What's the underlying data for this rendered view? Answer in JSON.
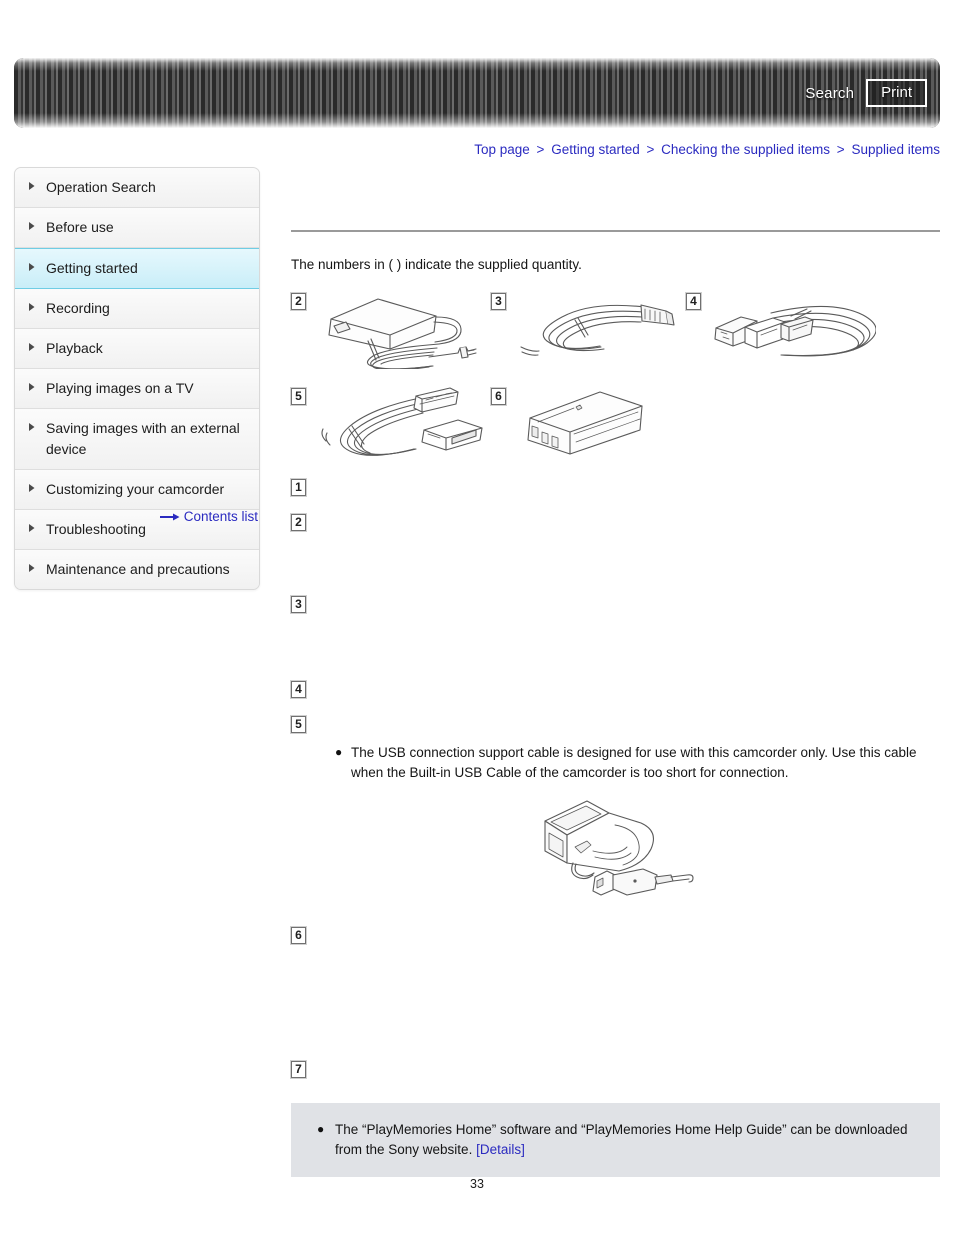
{
  "header": {
    "search_label": "Search",
    "print_label": "Print"
  },
  "breadcrumb": {
    "separator": ">",
    "items": [
      {
        "label": "Top page"
      },
      {
        "label": "Getting started"
      },
      {
        "label": "Checking the supplied items"
      },
      {
        "label": "Supplied items"
      }
    ]
  },
  "sidebar": {
    "items": [
      {
        "label": "Operation Search",
        "active": false
      },
      {
        "label": "Before use",
        "active": false
      },
      {
        "label": "Getting started",
        "active": true
      },
      {
        "label": "Recording",
        "active": false
      },
      {
        "label": "Playback",
        "active": false
      },
      {
        "label": "Playing images on a TV",
        "active": false
      },
      {
        "label": "Saving images with an external device",
        "active": false
      },
      {
        "label": "Customizing your camcorder",
        "active": false
      },
      {
        "label": "Troubleshooting",
        "active": false
      },
      {
        "label": "Maintenance and precautions",
        "active": false
      }
    ],
    "contents_list_label": "Contents list"
  },
  "main": {
    "intro": "The numbers in ( ) indicate the supplied quantity.",
    "figures": [
      {
        "number": "2",
        "art": "ac-adaptor"
      },
      {
        "number": "3",
        "art": "power-cord"
      },
      {
        "number": "4",
        "art": "hdmi-cable"
      },
      {
        "number": "5",
        "art": "usb-support-cable"
      },
      {
        "number": "6",
        "art": "battery-pack"
      }
    ],
    "captions": [
      {
        "number": "1",
        "text": ""
      },
      {
        "number": "2",
        "text": ""
      },
      {
        "number": "3",
        "text": ""
      },
      {
        "number": "4",
        "text": ""
      },
      {
        "number": "5",
        "text": ""
      },
      {
        "number": "6",
        "text": ""
      },
      {
        "number": "7",
        "text": ""
      }
    ],
    "usb_note_bullet": "●",
    "usb_note": "The USB connection support cable is designed for use with this camcorder only. Use this cable when the Built-in USB Cable of the camcorder is too short for connection.",
    "camcorder_art": "camcorder-with-usb-cable"
  },
  "bottom_note": {
    "bullet": "●",
    "text": "The “PlayMemories Home” software and “PlayMemories Home Help Guide” can be downloaded from the Sony website. ",
    "link_label": "[Details]"
  },
  "footer": {
    "page_number": "33"
  },
  "colors": {
    "link": "#2b2bc0",
    "active_item": "#c9eef8",
    "note_background": "#e0e2e6"
  }
}
